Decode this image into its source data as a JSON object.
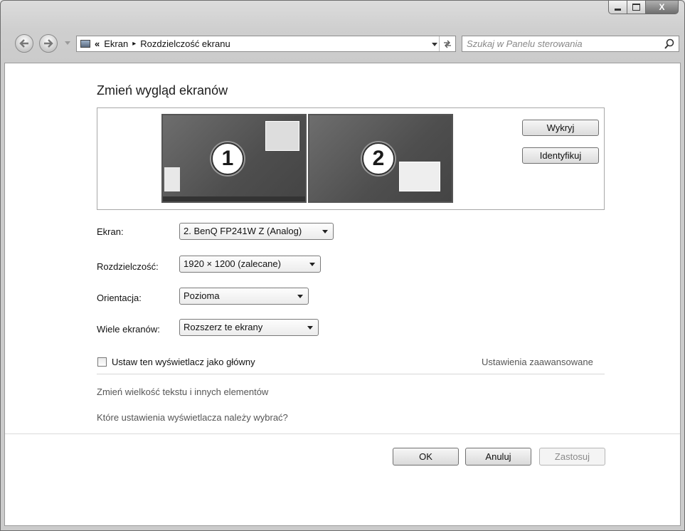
{
  "titlebar": {
    "minimize_icon": "minimize-icon",
    "maximize_icon": "maximize-icon",
    "close_label": "X"
  },
  "navigation": {
    "back_icon": "back-arrow-icon",
    "forward_icon": "forward-arrow-icon",
    "breadcrumb_prefix": "«",
    "breadcrumb": [
      "Ekran",
      "Rozdzielczość ekranu"
    ],
    "breadcrumb_separator": "▸",
    "search_placeholder": "Szukaj w Panelu sterowania"
  },
  "page": {
    "title": "Zmień wygląd ekranów",
    "monitors": [
      {
        "number": "1"
      },
      {
        "number": "2"
      }
    ],
    "detect_button": "Wykryj",
    "identify_button": "Identyfikuj"
  },
  "settings": {
    "display": {
      "label": "Ekran:",
      "value": "2. BenQ FP241W Z (Analog)"
    },
    "resolution": {
      "label": "Rozdzielczość:",
      "value": "1920 × 1200 (zalecane)"
    },
    "orientation": {
      "label": "Orientacja:",
      "value": "Pozioma"
    },
    "multiple": {
      "label": "Wiele ekranów:",
      "value": "Rozszerz te ekrany"
    }
  },
  "main_display_checkbox": {
    "label": "Ustaw ten wyświetlacz jako główny",
    "checked": false
  },
  "links": {
    "advanced": "Ustawienia zaawansowane",
    "text_size": "Zmień wielkość tekstu i innych elementów",
    "which_settings": "Które ustawienia wyświetlacza należy wybrać?"
  },
  "buttons": {
    "ok": "OK",
    "cancel": "Anuluj",
    "apply": "Zastosuj"
  }
}
